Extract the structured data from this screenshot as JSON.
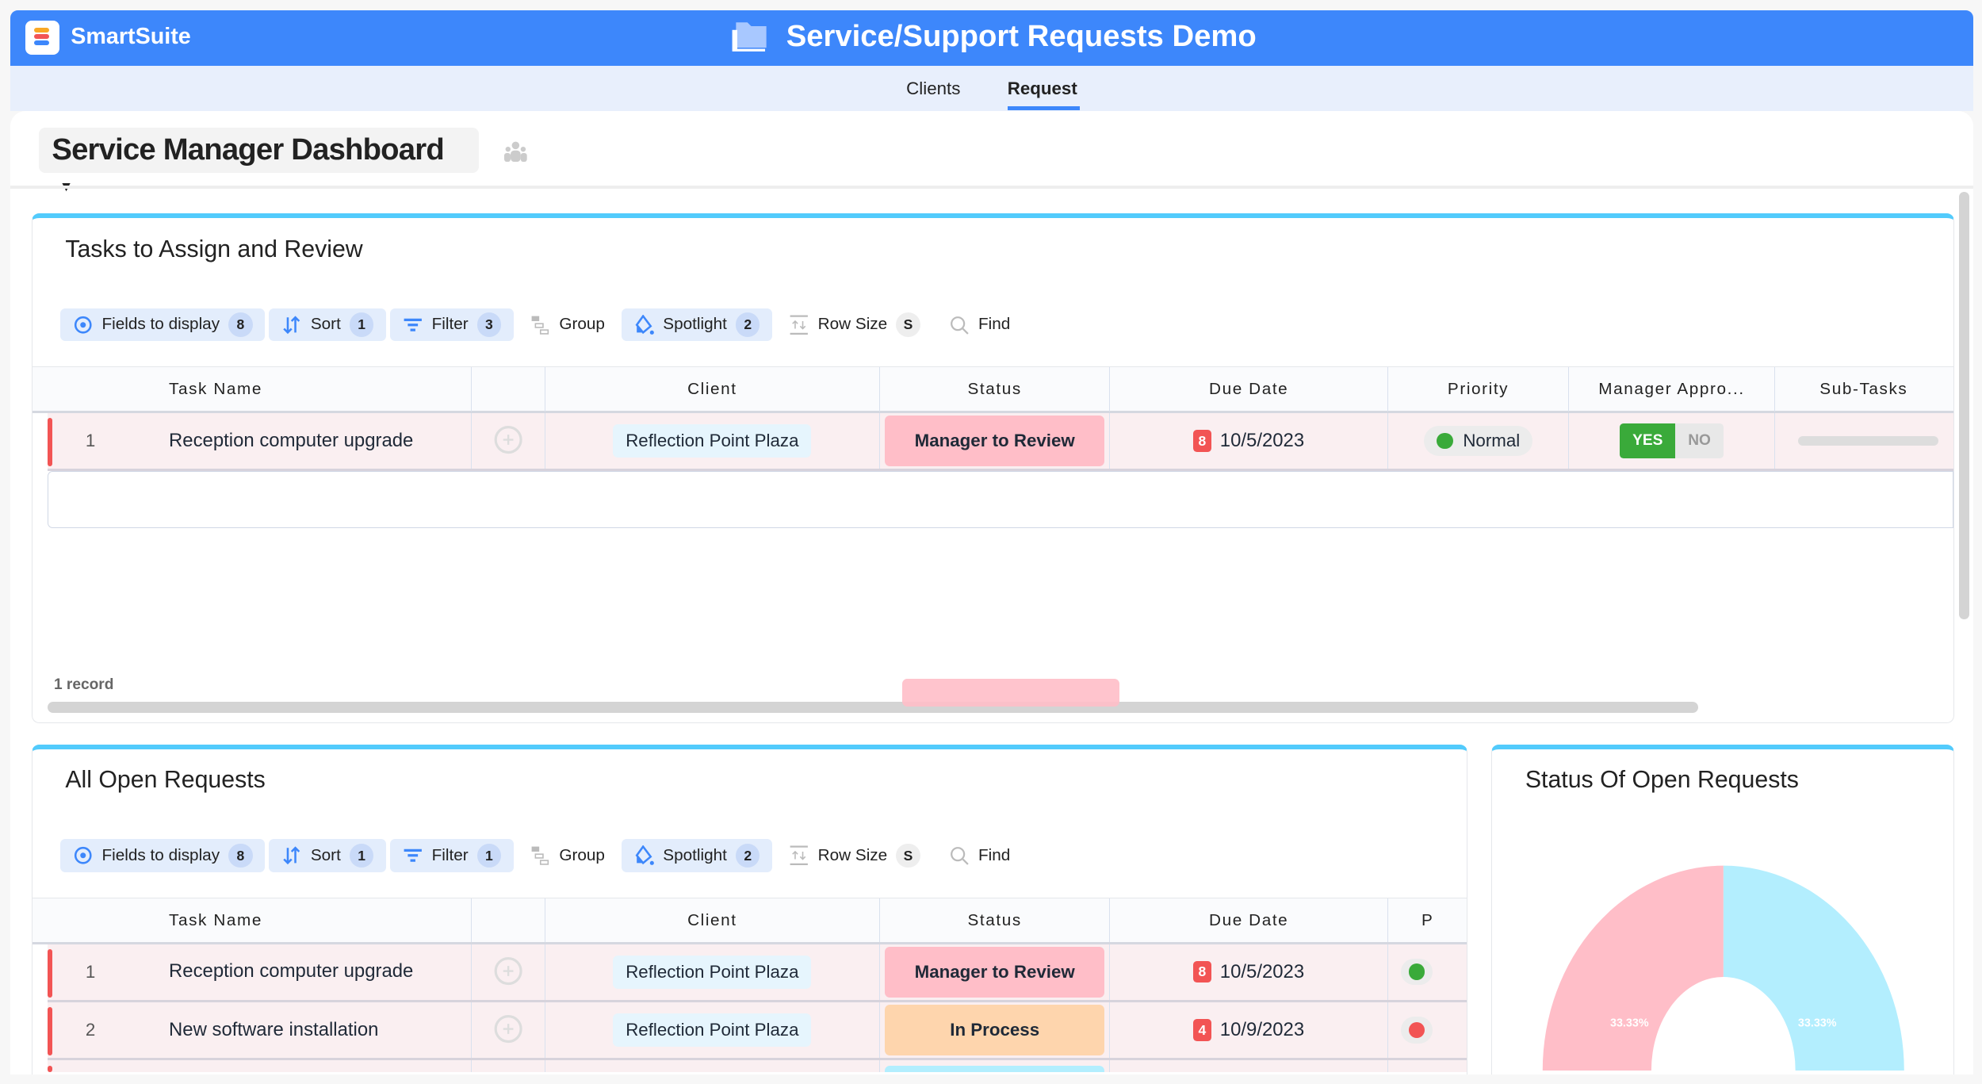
{
  "app": {
    "brand": "SmartSuite",
    "title": "Service/Support Requests Demo",
    "nav_tabs": [
      {
        "label": "Clients",
        "active": false
      },
      {
        "label": "Request",
        "active": true
      }
    ],
    "accent": "#3d87fb"
  },
  "dashboard": {
    "title": "Service Manager Dashboard"
  },
  "widgets": [
    {
      "title": "Tasks to Assign and Review",
      "toolbar": [
        {
          "icon": "eye-icon",
          "label": "Fields to display",
          "count": "8",
          "active": true
        },
        {
          "icon": "sort-icon",
          "label": "Sort",
          "count": "1",
          "active": true
        },
        {
          "icon": "filter-icon",
          "label": "Filter",
          "count": "3",
          "active": true
        },
        {
          "icon": "group-icon",
          "label": "Group",
          "active": false
        },
        {
          "icon": "spotlight-icon",
          "label": "Spotlight",
          "count": "2",
          "active": true
        },
        {
          "icon": "row-size-icon",
          "label": "Row Size",
          "count": "S",
          "active": false
        },
        {
          "icon": "search-icon",
          "label": "Find",
          "active": false
        }
      ],
      "columns": [
        "Task Name",
        "",
        "Client",
        "Status",
        "Due Date",
        "Priority",
        "Manager Appro...",
        "Sub-Tasks"
      ],
      "rows": [
        {
          "num": "1",
          "task": "Reception computer upgrade",
          "client": "Reflection Point Plaza",
          "status": "Manager to Review",
          "status_color": "#ffbec8",
          "due_badge": "8",
          "due": "10/5/2023",
          "priority": "Normal",
          "priority_color": "#3aaa3a",
          "approval_yes": "YES",
          "approval_no": "NO",
          "approval": "yes"
        }
      ],
      "footer": "1 record"
    },
    {
      "title": "All Open Requests",
      "toolbar": [
        {
          "icon": "eye-icon",
          "label": "Fields to display",
          "count": "8",
          "active": true
        },
        {
          "icon": "sort-icon",
          "label": "Sort",
          "count": "1",
          "active": true
        },
        {
          "icon": "filter-icon",
          "label": "Filter",
          "count": "1",
          "active": true
        },
        {
          "icon": "group-icon",
          "label": "Group",
          "active": false
        },
        {
          "icon": "spotlight-icon",
          "label": "Spotlight",
          "count": "2",
          "active": true
        },
        {
          "icon": "row-size-icon",
          "label": "Row Size",
          "count": "S",
          "active": false
        },
        {
          "icon": "search-icon",
          "label": "Find",
          "active": false
        }
      ],
      "columns": [
        "Task Name",
        "",
        "Client",
        "Status",
        "Due Date",
        "P"
      ],
      "rows": [
        {
          "num": "1",
          "task": "Reception computer upgrade",
          "client": "Reflection Point Plaza",
          "status": "Manager to Review",
          "status_color": "#ffbec8",
          "due_badge": "8",
          "due": "10/5/2023",
          "priority_color": "#3aaa3a"
        },
        {
          "num": "2",
          "task": "New software installation",
          "client": "Reflection Point Plaza",
          "status": "In Process",
          "status_color": "#fed5ad",
          "due_badge": "4",
          "due": "10/9/2023",
          "priority_color": "#f25454"
        },
        {
          "status_color": "#b3eefe"
        }
      ]
    }
  ],
  "chart_data": {
    "type": "pie",
    "donut": true,
    "title": "Status Of Open Requests",
    "slices": [
      {
        "value": 33.33,
        "label": "33.33%",
        "color": "#b3eefe"
      },
      {
        "value": 33.33,
        "label": "33.33%",
        "color": "#ffbec8"
      }
    ]
  }
}
